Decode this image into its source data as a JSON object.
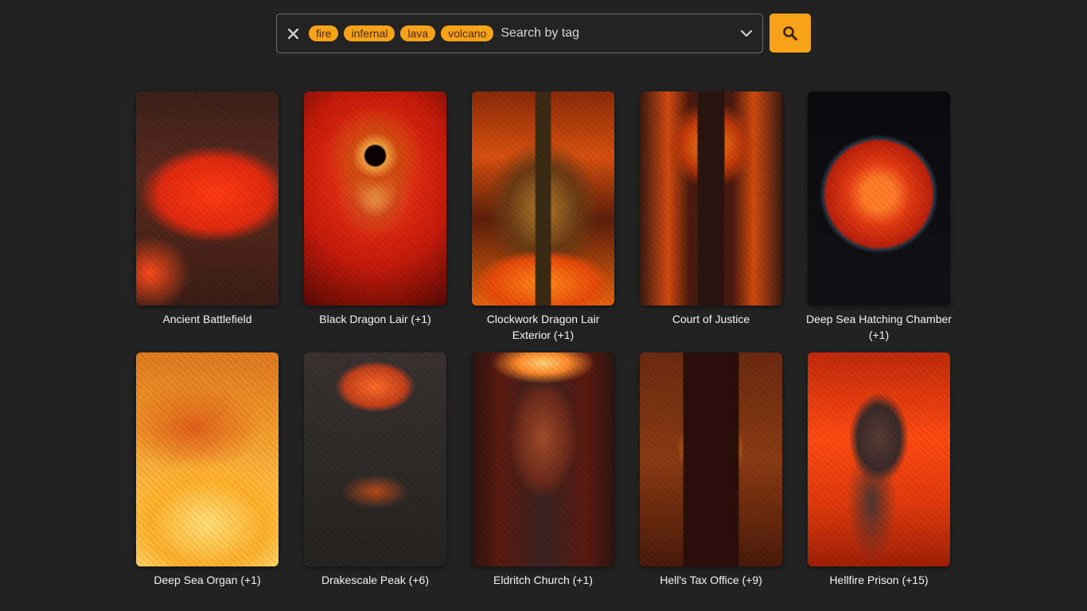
{
  "search": {
    "tags": [
      "fire",
      "infernal",
      "lava",
      "volcano"
    ],
    "placeholder": "Search by tag",
    "value": ""
  },
  "colors": {
    "accent": "#f6a31a",
    "background": "#222222"
  },
  "icons": {
    "clear": "close-icon",
    "dropdown": "chevron-down-icon",
    "search": "search-icon"
  },
  "maps": [
    {
      "title": "Ancient Battlefield"
    },
    {
      "title": "Black Dragon Lair (+1)"
    },
    {
      "title": "Clockwork Dragon Lair Exterior (+1)"
    },
    {
      "title": "Court of Justice"
    },
    {
      "title": "Deep Sea Hatching Chamber (+1)"
    },
    {
      "title": "Deep Sea Organ (+1)"
    },
    {
      "title": "Drakescale Peak (+6)"
    },
    {
      "title": "Eldritch Church (+1)"
    },
    {
      "title": "Hell's Tax Office (+9)"
    },
    {
      "title": "Hellfire Prison (+15)"
    }
  ]
}
